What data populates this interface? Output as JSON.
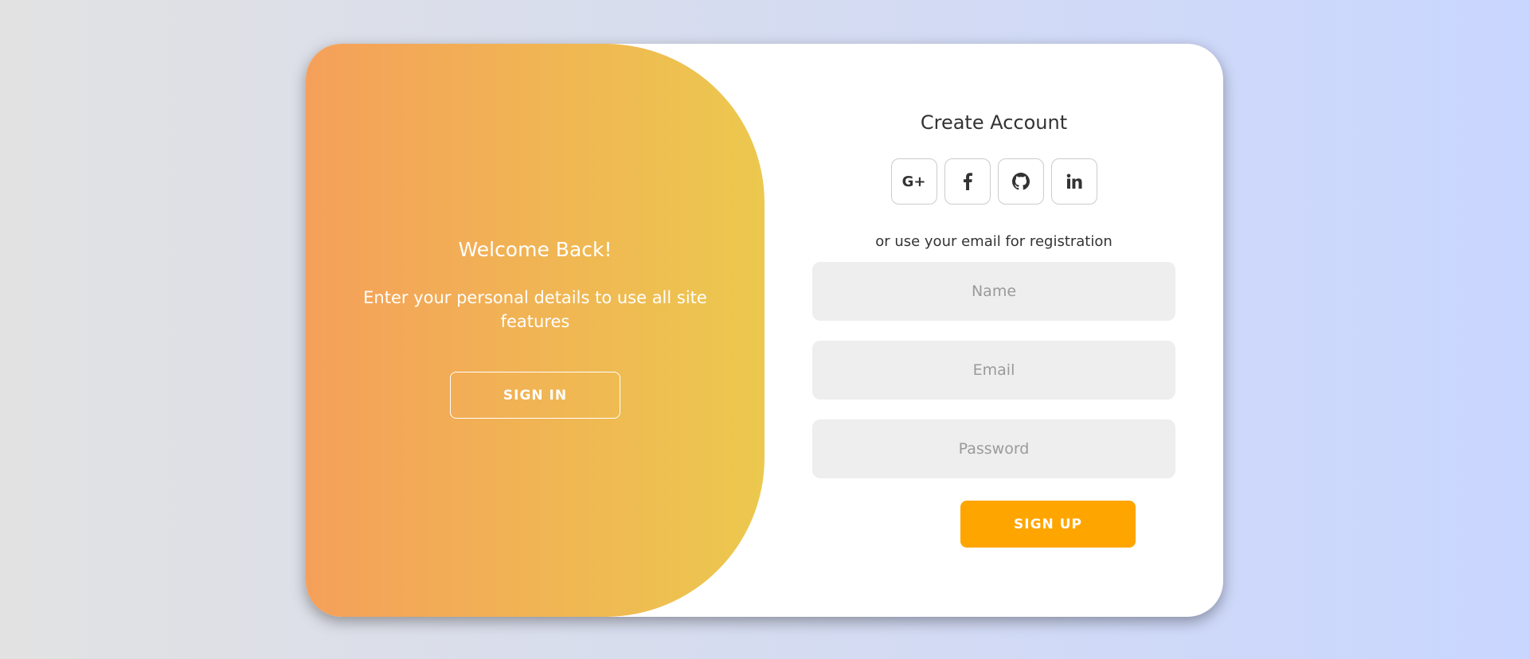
{
  "theme": {
    "background_gradient": [
      "#e2e2e2",
      "#c9d6ff"
    ],
    "panel_gradient": [
      "#f5a05a",
      "#ecc84e"
    ],
    "accent": "#ffa500",
    "card_background": "#ffffff"
  },
  "toggle_panel": {
    "title": "Welcome Back!",
    "text": "Enter your personal details to use all site features",
    "signin_label": "SIGN IN"
  },
  "signup_form": {
    "title": "Create Account",
    "social_icons": [
      {
        "name": "google-plus-icon",
        "label": "G+"
      },
      {
        "name": "facebook-icon"
      },
      {
        "name": "github-icon"
      },
      {
        "name": "linkedin-icon"
      }
    ],
    "or_text": "or use your email for registration",
    "fields": {
      "name_placeholder": "Name",
      "email_placeholder": "Email",
      "password_placeholder": "Password"
    },
    "signup_label": "SIGN UP"
  }
}
